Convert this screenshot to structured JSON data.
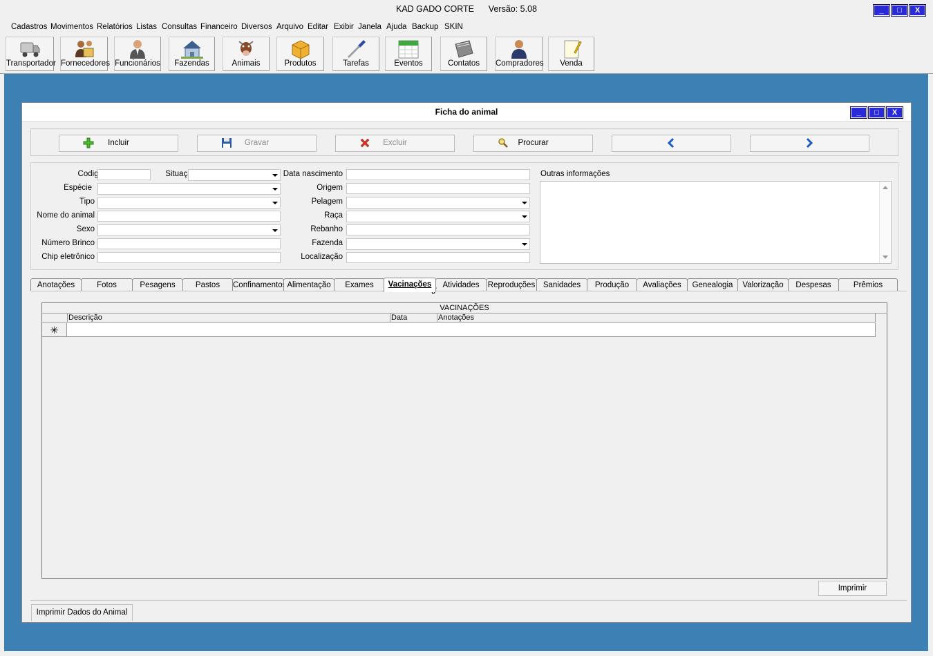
{
  "app": {
    "title": "KAD GADO CORTE      Versão: 5.08",
    "win_min": "_",
    "win_max": "□",
    "win_close": "X"
  },
  "menu": [
    "Cadastros",
    "Movimentos",
    "Relatórios",
    "Listas",
    "Consultas",
    "Financeiro",
    "Diversos",
    "Arquivo",
    "Editar",
    "Exibir",
    "Janela",
    "Ajuda",
    "Backup",
    "SKIN"
  ],
  "toolbar": [
    {
      "label": "Transportador",
      "icon": "truck-icon"
    },
    {
      "label": "Fornecedores",
      "icon": "suppliers-icon"
    },
    {
      "label": "Funcionários",
      "icon": "employee-icon"
    },
    {
      "label": "Fazendas",
      "icon": "farm-house-icon"
    },
    {
      "label": "Animais",
      "icon": "cow-icon"
    },
    {
      "label": "Produtos",
      "icon": "box-icon"
    },
    {
      "label": "Tarefas",
      "icon": "screwdriver-icon"
    },
    {
      "label": "Eventos",
      "icon": "calendar-icon"
    },
    {
      "label": "Contatos",
      "icon": "address-book-icon"
    },
    {
      "label": "Compradores",
      "icon": "buyer-icon"
    },
    {
      "label": "Venda",
      "icon": "notepad-icon"
    }
  ],
  "child": {
    "title": "Ficha do animal",
    "actions": {
      "incluir": "Incluir",
      "gravar": "Gravar",
      "excluir": "Excluir",
      "procurar": "Procurar"
    },
    "fields": {
      "codigo": "Codigo",
      "situacao": "Situação",
      "data_nascimento": "Data nascimento",
      "outras_informacoes": "Outras informações",
      "especie": "Espécie",
      "origem": "Origem",
      "tipo": "Tipo",
      "pelagem": "Pelagem",
      "nome_animal": "Nome do animal",
      "raca": "Raça",
      "sexo": "Sexo",
      "rebanho": "Rebanho",
      "numero_brinco": "Número Brinco",
      "fazenda": "Fazenda",
      "chip": "Chip eletrônico",
      "localizacao": "Localização"
    },
    "tabs": [
      "Anotações",
      "Fotos",
      "Pesagens",
      "Pastos",
      "Confinamentos",
      "Alimentação",
      "Exames",
      "Vacinações",
      "Atividades",
      "Reproduções",
      "Sanidades",
      "Produção",
      "Avaliações",
      "Genealogia",
      "Valorização",
      "Despesas",
      "Prêmios"
    ],
    "active_tab": "Vacinações",
    "grid": {
      "caption": "VACINAÇÕES",
      "columns": [
        "Descrição",
        "Data",
        "Anotações"
      ],
      "new_row_marker": "✳"
    },
    "print_button": "Imprimir",
    "bottom_tab": "Imprimir Dados do Animal"
  },
  "colors": {
    "desktop": "#3d80b3",
    "window_button": "#2a2ad6",
    "chrome": "#f0f0f0"
  }
}
